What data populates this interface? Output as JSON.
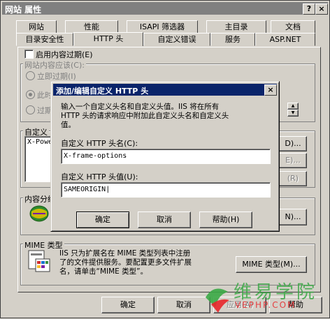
{
  "window": {
    "title": "网站 属性",
    "help_btn": "?",
    "close_btn": "×"
  },
  "tabs_row1": [
    "网站",
    "性能",
    "ISAPI 筛选器",
    "主目录",
    "文档"
  ],
  "tabs_row2": [
    "目录安全性",
    "HTTP 头",
    "自定义错误",
    "服务",
    "ASP.NET"
  ],
  "expiry": {
    "enable_label": "启用内容过期(E)",
    "should_label": "网站内容应该(C):",
    "opt_immediate": "立即过期(I)",
    "opt_after": "此时",
    "opt_expire": "过期"
  },
  "custom_headers": {
    "group_label": "自定义",
    "list_item": "X-Powe",
    "add_btn": "D)...",
    "edit_btn": "E)...",
    "remove_btn": "(R)"
  },
  "content_rating": {
    "group_label": "内容分级",
    "edit_btn": "N)..."
  },
  "mime": {
    "group_label": "MIME 类型",
    "desc": "IIS 只为扩展名在 MIME 类型列表中注册了的文件提供服务。要配置更多文件扩展名，请单击“MIME 类型”。",
    "desc_line1": "IIS 只为扩展名在 MIME 类型列表中注册",
    "desc_line2": "了的文件提供服务。要配置更多文件扩展",
    "desc_line3": "名，请单击“MIME 类型”。",
    "button": "MIME 类型(M)..."
  },
  "footer": {
    "ok": "确定",
    "cancel": "取消",
    "apply": "应用(A)",
    "help": "帮助"
  },
  "dialog": {
    "title": "添加/编辑自定义 HTTP 头",
    "close_btn": "×",
    "instruction_line1": "输入一个自定义头名和自定义头值。IIS 将在所有",
    "instruction_line2": "HTTP 头的请求响应中附加此自定义头名和自定义头",
    "instruction_line3": "值。",
    "name_label": "自定义 HTTP 头名(C):",
    "name_value": "X-frame-options",
    "value_label": "自定义 HTTP 头值(U):",
    "value_value": "SAMEORIGIN",
    "ok": "确定",
    "cancel": "取消",
    "help": "帮助(H)"
  },
  "watermark": {
    "text_cn": "维易学院",
    "text_en": "VEPHP.COM",
    "color_green": "#3aa845",
    "color_red": "#e8262a"
  }
}
